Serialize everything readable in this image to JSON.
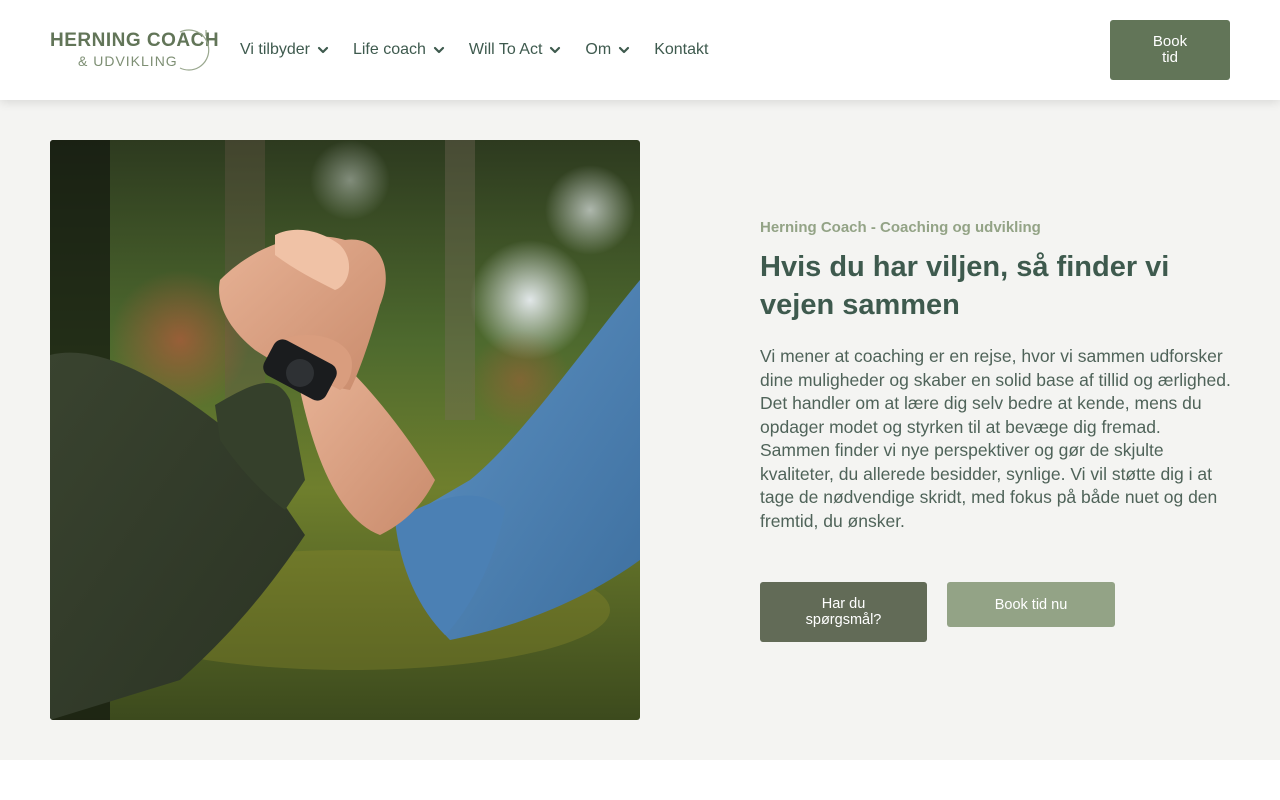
{
  "logo": {
    "line1": "HERNING COACH",
    "line2": "& UDVIKLING"
  },
  "nav": {
    "items": [
      {
        "label": "Vi tilbyder",
        "has_dropdown": true
      },
      {
        "label": "Life coach",
        "has_dropdown": true
      },
      {
        "label": "Will To Act",
        "has_dropdown": true
      },
      {
        "label": "Om",
        "has_dropdown": true
      },
      {
        "label": "Kontakt",
        "has_dropdown": false
      }
    ]
  },
  "header": {
    "book_label": "Book tid"
  },
  "hero": {
    "image_icon": "handshake-photo",
    "kicker": "Herning Coach - Coaching og udvikling",
    "headline": "Hvis du har viljen, så finder vi vejen sammen",
    "body": "Vi mener at coaching er en rejse, hvor vi sammen udforsker dine muligheder og skaber en solid base af tillid og ærlighed. Det handler om at lære dig selv bedre at kende, mens du opdager modet og styrken til at bevæge dig fremad. Sammen finder vi nye perspektiver og gør de skjulte kvaliteter, du allerede besidder, synlige. Vi vil støtte dig i at tage de nødvendige skridt, med fokus på både nuet og den fremtid, du ønsker.",
    "questions_label": "Har du spørgsmål?",
    "book_now_label": "Book tid nu"
  },
  "colors": {
    "brand_green": "#627558",
    "dark_olive": "#626b57",
    "sage": "#93a386",
    "heading": "#3e5a4e",
    "section_bg": "#f4f4f2"
  }
}
